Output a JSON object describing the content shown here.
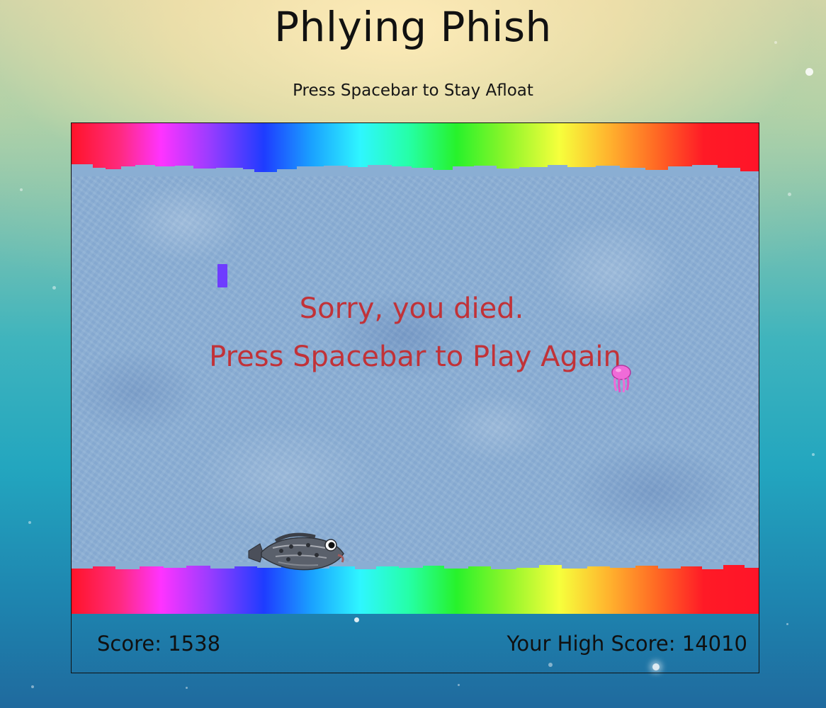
{
  "header": {
    "title": "Phlying Phish",
    "subtitle": "Press Spacebar to Stay Afloat"
  },
  "game": {
    "overlay": {
      "line1": "Sorry, you died.",
      "line2": "Press Spacebar to Play Again"
    },
    "score_label": "Score: 1538",
    "high_score_label": "Your High Score: 14010",
    "score": 1538,
    "high_score": 14010,
    "sprites": {
      "player": "fish-icon",
      "enemy": "jellyfish-icon",
      "obstacle": "purple-bar"
    },
    "colors": {
      "overlay_text": "#c13238",
      "water": "#8aaed3",
      "obstacle": "#6e3cff"
    }
  }
}
